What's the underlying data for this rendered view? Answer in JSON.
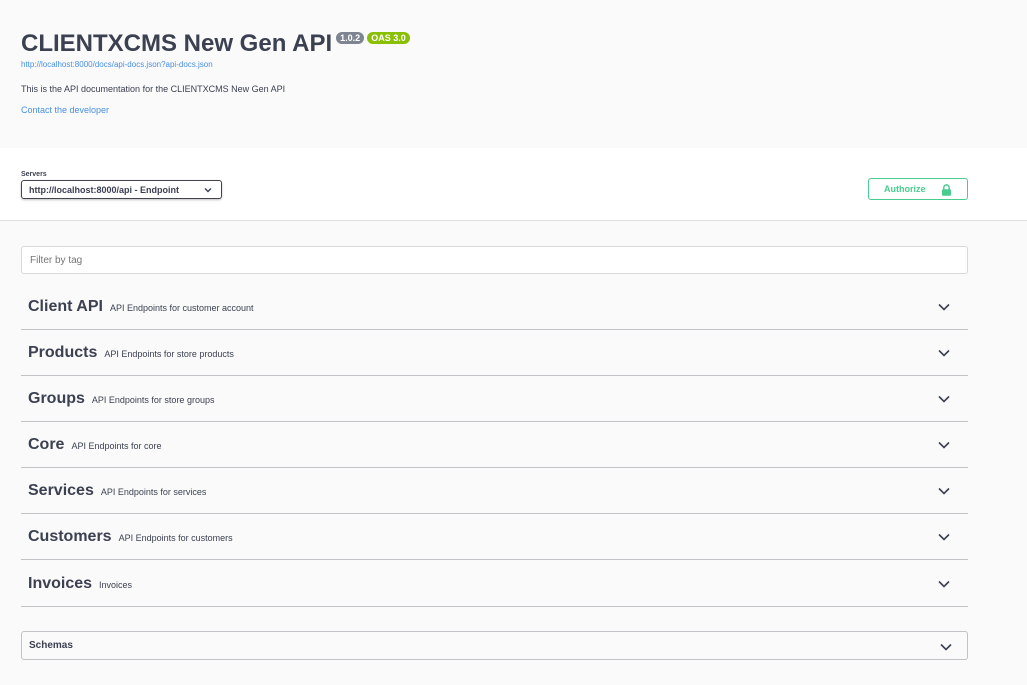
{
  "info": {
    "title": "CLIENTXCMS New Gen API",
    "version_badge": "1.0.2",
    "oas_badge": "OAS 3.0",
    "spec_url": "http://localhost:8000/docs/api-docs.json?api-docs.json",
    "description": "This is the API documentation for the CLIENTXCMS New Gen API",
    "contact_label": "Contact the developer"
  },
  "servers": {
    "label": "Servers",
    "selected": "http://localhost:8000/api - Endpoint"
  },
  "authorize": {
    "label": "Authorize",
    "color": "#49cc90"
  },
  "filter": {
    "placeholder": "Filter by tag",
    "value": ""
  },
  "tags": [
    {
      "name": "Client API",
      "description": "API Endpoints for customer account"
    },
    {
      "name": "Products",
      "description": "API Endpoints for store products"
    },
    {
      "name": "Groups",
      "description": "API Endpoints for store groups"
    },
    {
      "name": "Core",
      "description": "API Endpoints for core"
    },
    {
      "name": "Services",
      "description": "API Endpoints for services"
    },
    {
      "name": "Customers",
      "description": "API Endpoints for customers"
    },
    {
      "name": "Invoices",
      "description": "Invoices"
    }
  ],
  "schemas": {
    "label": "Schemas"
  },
  "colors": {
    "link": "#4990e2",
    "text": "#3b4151",
    "version_badge": "#7d8492",
    "oas_badge": "#89bf04"
  }
}
